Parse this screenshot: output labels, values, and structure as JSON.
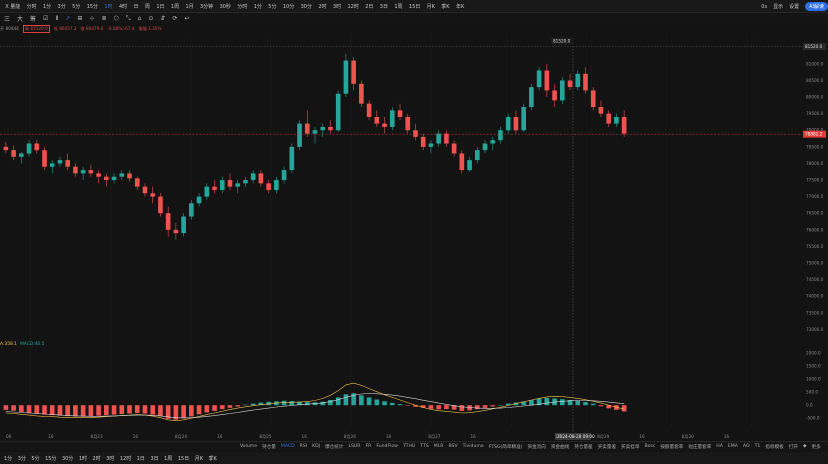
{
  "top_toolbar": {
    "symbol": "X 量能",
    "items": [
      "分时",
      "1分",
      "3分",
      "5分",
      "15分",
      "1时",
      "4时",
      "日",
      "周",
      "1日",
      "1周",
      "1月",
      "3分钟",
      "30秒",
      "分时",
      "1分",
      "5分",
      "10分",
      "30分",
      "2时",
      "3时",
      "12时",
      "2日",
      "3日",
      "1周",
      "15日",
      "月K",
      "季K",
      "年K"
    ],
    "active_index": 5,
    "right": [
      "0s",
      "显示",
      "设置"
    ],
    "right_button": "AI解读"
  },
  "draw_toolbar": {
    "items": [
      "三",
      "大",
      "筹",
      "☑",
      "Ⅱ",
      "↗",
      "⊞",
      "⊹",
      "≣",
      "⬡",
      "⤡",
      "⌂",
      "⊙",
      "⇵",
      "⟳",
      "↩"
    ],
    "selected_index": 5
  },
  "ohlc": {
    "open": "开 80444",
    "high": "高 81520.0",
    "low": "低 80457.2",
    "close": "收 80479.6",
    "change": "-0.08%/-67.4",
    "amp": "振幅 1.35%"
  },
  "price_axis": {
    "labels": [
      "81500.0",
      "81000.0",
      "80500.0",
      "80000.0",
      "79500.0",
      "79000.0",
      "78500.0",
      "78000.0",
      "77500.0",
      "77000.0",
      "76500.0",
      "76000.0",
      "75500.0",
      "75000.0",
      "74500.0",
      "74000.0",
      "73500.0",
      "73000.0"
    ],
    "last_price": "78882.2",
    "crosshair_price": "81520.0",
    "highlight_color": "#e23b3b"
  },
  "macd": {
    "label_dif": "A:358.1",
    "label_macd": "MACD:46.5",
    "axis": [
      "2000.0",
      "1500.0",
      "1000.0",
      "500.0",
      "0.0",
      "-500.0"
    ]
  },
  "time_axis": {
    "labels": [
      "09",
      "16",
      "8月23",
      "16",
      "8月24",
      "16",
      "8月25",
      "16",
      "8月26",
      "16",
      "8月27",
      "16",
      "2024-08-28 09:00",
      "16",
      "8月29",
      "16",
      "8月30",
      "16"
    ],
    "highlight_index": 12
  },
  "indicator_bar": {
    "items": [
      "Volume",
      "持仓量",
      "MACD",
      "RSI",
      "KDJ",
      "爆仓统计",
      "LSUR",
      "FR",
      "FundFlow",
      "TTHU",
      "TTS",
      "MLR",
      "BSV",
      "Tividuma",
      "FTSG(简单精准)",
      "资金流向",
      "资金曲线",
      "持仓量差",
      "买卖量差",
      "买卖挂单",
      "Bosc",
      "按额量套率",
      "短庄量套率",
      "HA",
      "EMA",
      "AO",
      "T1"
    ],
    "selected_index": 2,
    "right": [
      "指标模板",
      "打开",
      "◆",
      "更多"
    ]
  },
  "bottom_bar": {
    "items": [
      "1分",
      "3分",
      "5分",
      "15分",
      "30分",
      "1时",
      "2时",
      "3时",
      "12时",
      "1日",
      "3日",
      "1周",
      "15日",
      "月K",
      "季K"
    ]
  },
  "colors": {
    "up": "#26a69a",
    "down": "#ef5350",
    "dif": "#f3c04a",
    "dea": "#d8d8d8",
    "accent": "#2f6fe0"
  },
  "chart_data": {
    "type": "candlestick",
    "candles": [
      [
        78500,
        78650,
        78300,
        78400
      ],
      [
        78400,
        78550,
        78100,
        78200
      ],
      [
        78200,
        78350,
        78000,
        78300
      ],
      [
        78300,
        78700,
        78200,
        78600
      ],
      [
        78600,
        78700,
        78300,
        78400
      ],
      [
        78400,
        78500,
        77800,
        77900
      ],
      [
        77900,
        78100,
        77700,
        78000
      ],
      [
        78000,
        78200,
        77900,
        78100
      ],
      [
        78100,
        78300,
        77800,
        77900
      ],
      [
        77900,
        78000,
        77600,
        77700
      ],
      [
        77700,
        77900,
        77500,
        77800
      ],
      [
        77800,
        77950,
        77600,
        77700
      ],
      [
        77700,
        77800,
        77400,
        77600
      ],
      [
        77600,
        77700,
        77300,
        77500
      ],
      [
        77500,
        77700,
        77400,
        77600
      ],
      [
        77600,
        77800,
        77500,
        77700
      ],
      [
        77700,
        77800,
        77450,
        77550
      ],
      [
        77550,
        77600,
        77200,
        77300
      ],
      [
        77300,
        77400,
        77000,
        77100
      ],
      [
        77100,
        77300,
        76800,
        77000
      ],
      [
        77000,
        77100,
        76400,
        76500
      ],
      [
        76500,
        76700,
        75800,
        76000
      ],
      [
        76000,
        76200,
        75700,
        75900
      ],
      [
        75900,
        76500,
        75800,
        76400
      ],
      [
        76400,
        76900,
        76300,
        76800
      ],
      [
        76800,
        77100,
        76700,
        77000
      ],
      [
        77000,
        77400,
        76900,
        77300
      ],
      [
        77300,
        77500,
        77100,
        77200
      ],
      [
        77200,
        77600,
        77100,
        77500
      ],
      [
        77500,
        77700,
        77200,
        77300
      ],
      [
        77300,
        77500,
        77100,
        77400
      ],
      [
        77400,
        77600,
        77300,
        77500
      ],
      [
        77500,
        77800,
        77400,
        77700
      ],
      [
        77700,
        77800,
        77300,
        77400
      ],
      [
        77400,
        77500,
        77100,
        77200
      ],
      [
        77200,
        77600,
        77100,
        77500
      ],
      [
        77500,
        77900,
        77400,
        77800
      ],
      [
        77800,
        78600,
        77700,
        78500
      ],
      [
        78500,
        79300,
        78400,
        79200
      ],
      [
        79200,
        79600,
        78800,
        78900
      ],
      [
        78900,
        79100,
        78600,
        79000
      ],
      [
        79000,
        79200,
        78800,
        79100
      ],
      [
        79100,
        79300,
        78900,
        79000
      ],
      [
        79000,
        80200,
        78950,
        80100
      ],
      [
        80100,
        81300,
        80000,
        81100
      ],
      [
        81100,
        81200,
        80200,
        80400
      ],
      [
        80400,
        80500,
        79700,
        79800
      ],
      [
        79800,
        79900,
        79300,
        79400
      ],
      [
        79400,
        79600,
        79100,
        79200
      ],
      [
        79200,
        79400,
        78900,
        79100
      ],
      [
        79100,
        79700,
        79000,
        79600
      ],
      [
        79600,
        79800,
        79300,
        79400
      ],
      [
        79400,
        79500,
        78900,
        79000
      ],
      [
        79000,
        79200,
        78700,
        78800
      ],
      [
        78800,
        78900,
        78400,
        78500
      ],
      [
        78500,
        78700,
        78300,
        78600
      ],
      [
        78600,
        79000,
        78500,
        78900
      ],
      [
        78900,
        79000,
        78500,
        78600
      ],
      [
        78600,
        78700,
        78200,
        78300
      ],
      [
        78300,
        78400,
        77700,
        77800
      ],
      [
        77800,
        78200,
        77750,
        78100
      ],
      [
        78100,
        78500,
        78000,
        78400
      ],
      [
        78400,
        78700,
        78300,
        78600
      ],
      [
        78600,
        78800,
        78400,
        78700
      ],
      [
        78700,
        79100,
        78600,
        79000
      ],
      [
        79000,
        79500,
        78900,
        79400
      ],
      [
        79400,
        79600,
        78900,
        79000
      ],
      [
        79000,
        79800,
        78950,
        79700
      ],
      [
        79700,
        80400,
        79600,
        80300
      ],
      [
        80300,
        80900,
        80200,
        80800
      ],
      [
        80800,
        81000,
        80000,
        80200
      ],
      [
        80200,
        80400,
        79700,
        79900
      ],
      [
        79900,
        80600,
        79800,
        80500
      ],
      [
        80500,
        80700,
        80200,
        80300
      ],
      [
        80300,
        80800,
        80200,
        80700
      ],
      [
        80700,
        80900,
        80100,
        80200
      ],
      [
        80200,
        80300,
        79600,
        79700
      ],
      [
        79700,
        79900,
        79400,
        79500
      ],
      [
        79500,
        79600,
        79100,
        79200
      ],
      [
        79200,
        79500,
        79100,
        79400
      ],
      [
        79400,
        79600,
        78800,
        78900
      ]
    ],
    "price_range": [
      72800,
      81900
    ],
    "macd_hist": [
      -180,
      -210,
      -260,
      -300,
      -330,
      -360,
      -380,
      -400,
      -420,
      -430,
      -440,
      -420,
      -400,
      -380,
      -360,
      -340,
      -320,
      -300,
      -320,
      -360,
      -420,
      -520,
      -560,
      -500,
      -430,
      -350,
      -280,
      -220,
      -150,
      -100,
      -50,
      20,
      60,
      100,
      130,
      150,
      170,
      160,
      140,
      120,
      110,
      130,
      200,
      300,
      420,
      460,
      380,
      300,
      220,
      150,
      90,
      40,
      -20,
      -60,
      -100,
      -140,
      -160,
      -150,
      -170,
      -220,
      -200,
      -150,
      -100,
      -50,
      0,
      60,
      100,
      140,
      200,
      260,
      280,
      260,
      230,
      200,
      170,
      120,
      60,
      -40,
      -120,
      -180,
      -240
    ],
    "macd_dif": [
      -300,
      -320,
      -350,
      -380,
      -410,
      -430,
      -440,
      -460,
      -470,
      -480,
      -480,
      -470,
      -460,
      -440,
      -420,
      -400,
      -380,
      -360,
      -380,
      -420,
      -480,
      -560,
      -600,
      -560,
      -500,
      -430,
      -360,
      -300,
      -230,
      -170,
      -110,
      -60,
      -20,
      20,
      50,
      80,
      100,
      110,
      120,
      140,
      180,
      260,
      380,
      560,
      780,
      850,
      760,
      640,
      520,
      400,
      300,
      200,
      100,
      0,
      -90,
      -160,
      -210,
      -240,
      -270,
      -300,
      -290,
      -250,
      -200,
      -140,
      -80,
      -10,
      60,
      130,
      200,
      260,
      320,
      340,
      330,
      300,
      260,
      210,
      150,
      80,
      0,
      -80,
      -150
    ],
    "macd_dea": [
      -250,
      -260,
      -280,
      -300,
      -320,
      -340,
      -360,
      -380,
      -400,
      -410,
      -420,
      -425,
      -425,
      -420,
      -410,
      -400,
      -390,
      -380,
      -380,
      -390,
      -410,
      -450,
      -480,
      -490,
      -480,
      -460,
      -430,
      -400,
      -360,
      -320,
      -280,
      -230,
      -190,
      -150,
      -110,
      -70,
      -40,
      -10,
      20,
      40,
      60,
      90,
      140,
      210,
      300,
      380,
      430,
      450,
      440,
      420,
      390,
      350,
      300,
      250,
      190,
      140,
      80,
      30,
      -20,
      -60,
      -90,
      -110,
      -120,
      -120,
      -110,
      -90,
      -60,
      -30,
      0,
      40,
      80,
      120,
      150,
      170,
      180,
      180,
      170,
      150,
      120,
      90,
      60
    ],
    "macd_range": [
      -800,
      2200
    ]
  }
}
